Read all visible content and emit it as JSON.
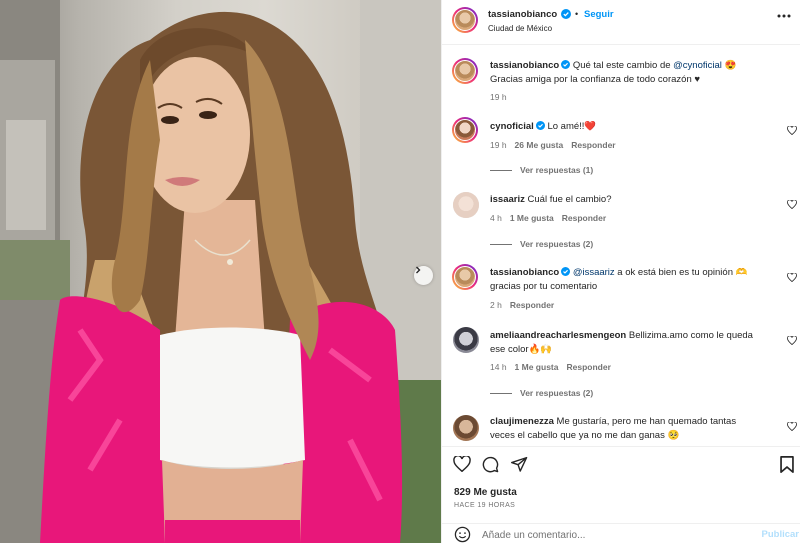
{
  "post": {
    "author": "tassianobianco",
    "follow_label": "Seguir",
    "separator": "•",
    "location": "Ciudad de México"
  },
  "caption": {
    "username": "tassianobianco",
    "text_before": "Qué tal este cambio de ",
    "mention": "@cynoficial",
    "emoji": "😍",
    "line2": "Gracias amiga por la confianza de todo corazón ♥",
    "time": "19 h"
  },
  "comments": [
    {
      "username": "cynoficial",
      "text": "Lo amé!!❤️",
      "time": "19 h",
      "likes": "26 Me gusta",
      "reply": "Responder",
      "view_replies": "Ver respuestas (1)"
    },
    {
      "username": "issaariz",
      "text": "Cuál fue el cambio?",
      "time": "4 h",
      "likes": "1 Me gusta",
      "reply": "Responder",
      "view_replies": "Ver respuestas (2)"
    },
    {
      "username": "tassianobianco",
      "mention": "@issaariz",
      "text": " a ok está bien es tu opinión 🫶",
      "line2": "gracias por tu comentario",
      "time": "2 h",
      "reply": "Responder"
    },
    {
      "username": "ameliaandreacharlesmengeon",
      "text": "Bellizima.amo como le queda",
      "line2": "ese color🔥🙌",
      "time": "14 h",
      "likes": "1 Me gusta",
      "reply": "Responder",
      "view_replies": "Ver respuestas (2)"
    },
    {
      "username": "claujimenezza",
      "text": "Me gustaría, pero me han quemado tantas",
      "line2": "veces el cabello que ya no me dan ganas 🥺"
    }
  ],
  "footer": {
    "likes": "829 Me gusta",
    "time_ago": "HACE 19 HORAS",
    "comment_placeholder": "Añade un comentario...",
    "publish_label": "Publicar"
  },
  "icons": {
    "verified": "verified-badge-icon",
    "more": "more-options-icon",
    "heart": "heart-icon",
    "comment": "comment-icon",
    "share": "share-icon",
    "save": "bookmark-icon",
    "emoji": "emoji-icon",
    "next": "chevron-right-icon"
  },
  "colors": {
    "accent": "#0095f6",
    "verified": "#0095f6",
    "mention": "#00376b",
    "muted": "#737373"
  }
}
